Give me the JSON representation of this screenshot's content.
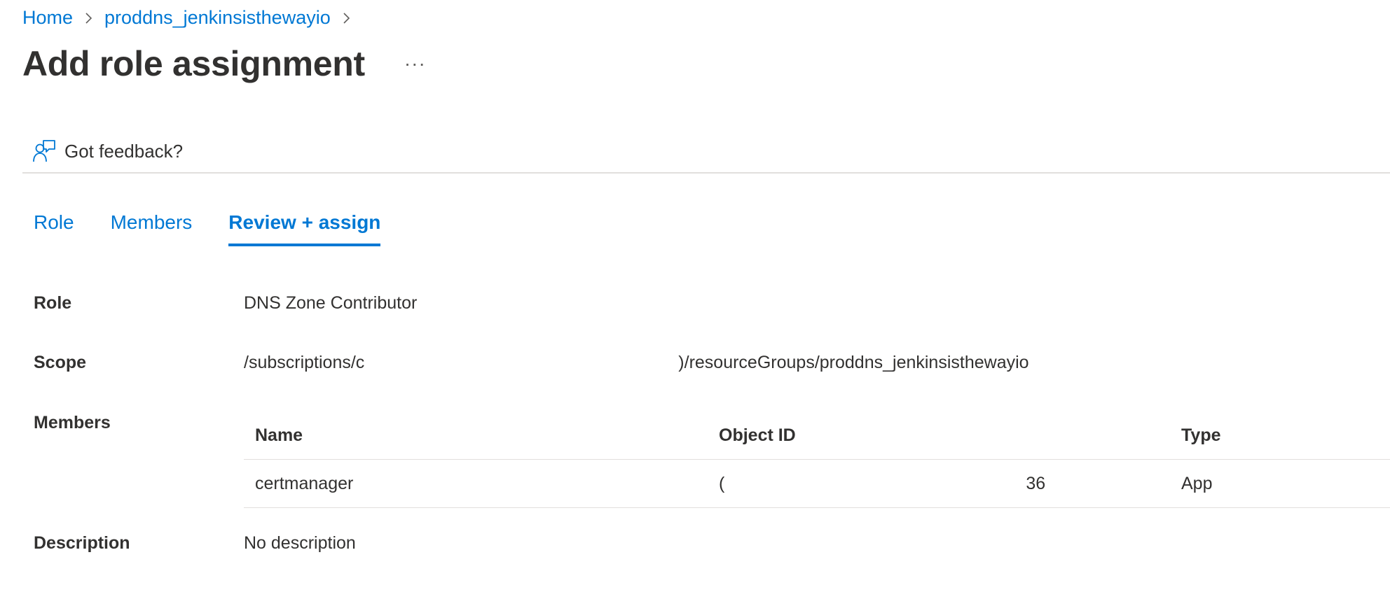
{
  "breadcrumb": [
    {
      "label": "Home"
    },
    {
      "label": "proddns_jenkinsisthewayio"
    }
  ],
  "page": {
    "title": "Add role assignment",
    "more_label": "···"
  },
  "command_bar": {
    "feedback_label": "Got feedback?",
    "feedback_icon": "feedback-person-icon"
  },
  "tabs": [
    {
      "label": "Role",
      "active": false
    },
    {
      "label": "Members",
      "active": false
    },
    {
      "label": "Review + assign",
      "active": true
    }
  ],
  "review": {
    "role_label": "Role",
    "role_value": "DNS Zone Contributor",
    "scope_label": "Scope",
    "scope_value_start": "/subscriptions/c",
    "scope_value_end": ")/resourceGroups/proddns_jenkinsisthewayio",
    "members_label": "Members",
    "description_label": "Description",
    "description_value": "No description"
  },
  "members_table": {
    "columns": [
      "Name",
      "Object ID",
      "Type"
    ],
    "rows": [
      {
        "name": "certmanager",
        "object_id_start": "(",
        "object_id_end": "36",
        "type": "App"
      }
    ]
  },
  "colors": {
    "accent": "#0078d4",
    "text": "#323130",
    "divider": "#e1dfdd"
  }
}
